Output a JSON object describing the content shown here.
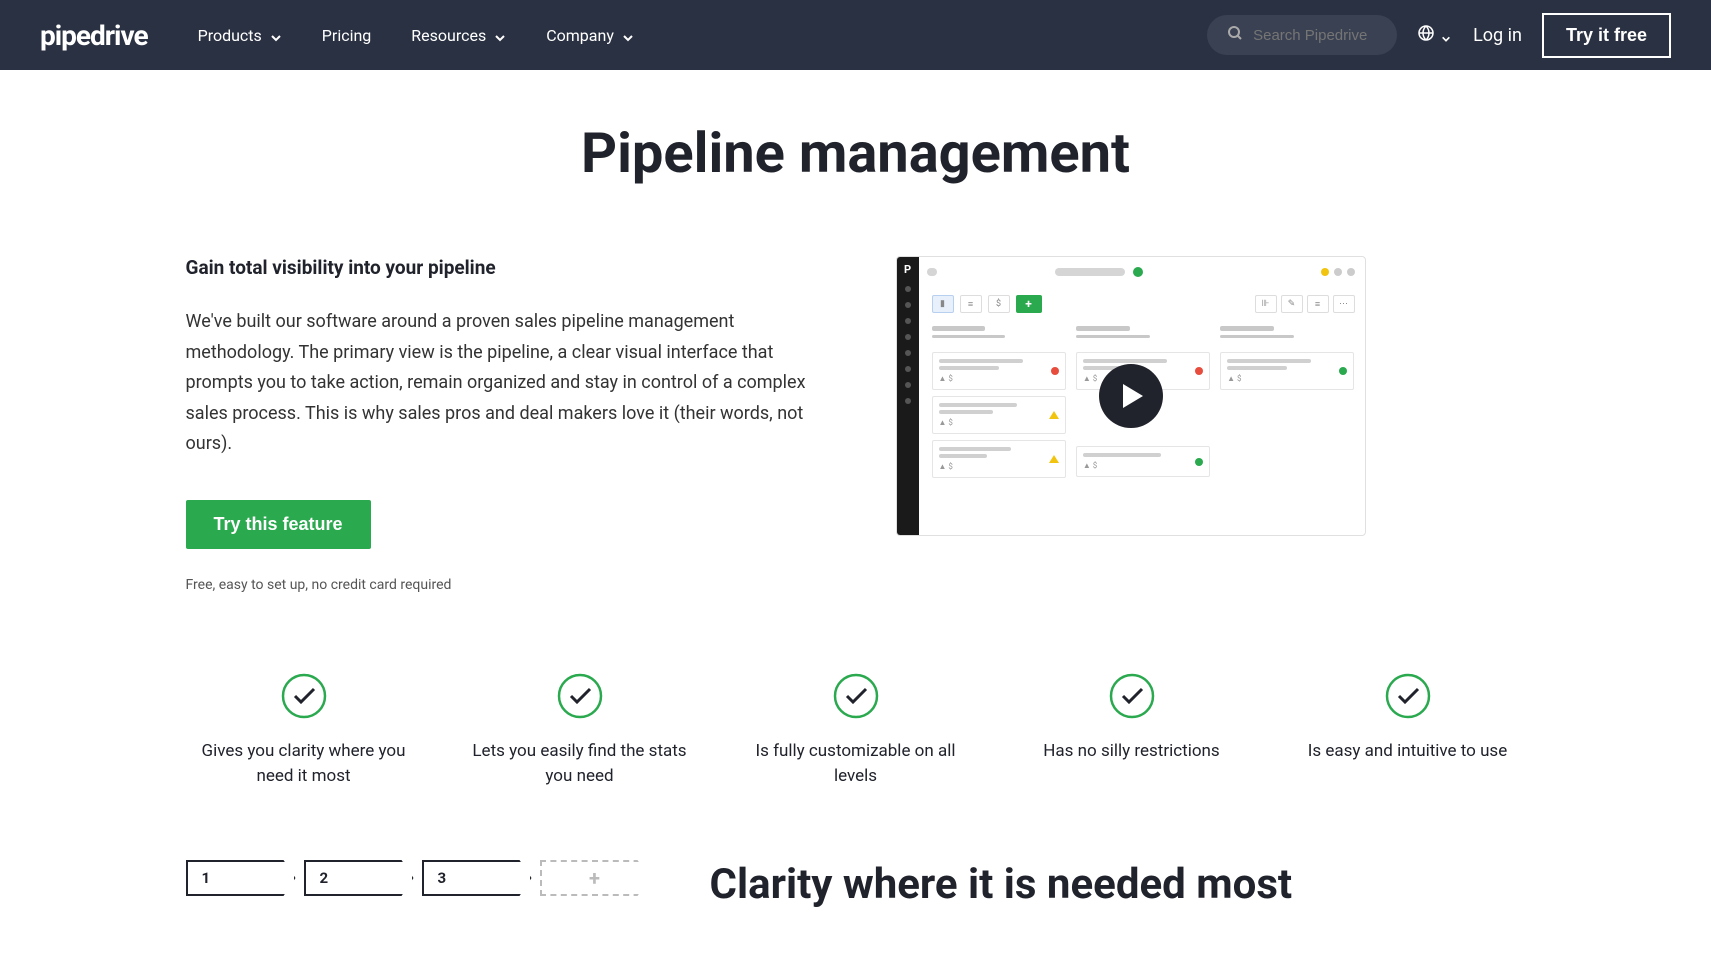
{
  "header": {
    "logo": "pipedrive",
    "nav": {
      "products": "Products",
      "pricing": "Pricing",
      "resources": "Resources",
      "company": "Company"
    },
    "search_placeholder": "Search Pipedrive",
    "login": "Log in",
    "try_free": "Try it free"
  },
  "page": {
    "title": "Pipeline management",
    "subtitle": "Gain total visibility into your pipeline",
    "body": "We've built our software around a proven sales pipeline management methodology. The primary view is the pipeline, a clear visual interface that prompts you to take action, remain organized and stay in control of a complex sales process. This is why sales pros and deal makers love it (their words, not ours).",
    "cta": "Try this feature",
    "cta_note": "Free, easy to set up, no credit card required"
  },
  "features": [
    "Gives you clarity where you need it most",
    "Lets you easily find the stats you need",
    "Is fully customizable on all levels",
    "Has no silly restrictions",
    "Is easy and intuitive to use"
  ],
  "stages": [
    "1",
    "2",
    "3",
    "+"
  ],
  "bottom_title": "Clarity where it is needed most"
}
